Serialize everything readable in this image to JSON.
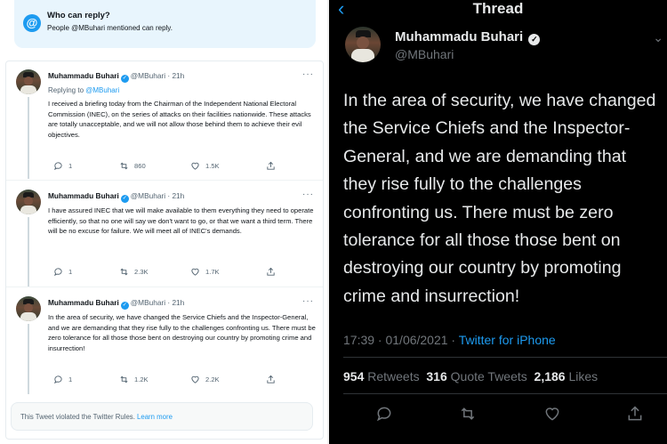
{
  "left": {
    "reply_banner": {
      "title": "Who can reply?",
      "subtitle": "People @MBuhari mentioned can reply."
    },
    "tweets": [
      {
        "name": "Muhammadu Buhari",
        "meta": "@MBuhari · 21h",
        "replying_prefix": "Replying to ",
        "replying_handle": "@MBuhari",
        "text": "I received a briefing today from the Chairman of the Independent National Electoral Commission (INEC), on the series of attacks on their facilities nationwide. These attacks are totally unacceptable, and we will not allow those behind them to achieve their evil objectives.",
        "replies": "1",
        "retweets": "860",
        "likes": "1.5K"
      },
      {
        "name": "Muhammadu Buhari",
        "meta": "@MBuhari · 21h",
        "text": "I have assured INEC that we will make available to them everything they need to operate efficiently, so that no one will say we don't want to go, or that we want a third term. There will be no excuse for failure. We will meet all of INEC's demands.",
        "replies": "1",
        "retweets": "2.3K",
        "likes": "1.7K"
      },
      {
        "name": "Muhammadu Buhari",
        "meta": "@MBuhari · 21h",
        "text": "In the area of security, we have changed the Service Chiefs and the Inspector-General, and we are demanding that they rise fully to the challenges confronting us. There must be zero tolerance for all those those bent on destroying our country by promoting crime and insurrection!",
        "replies": "1",
        "retweets": "1.2K",
        "likes": "2.2K"
      }
    ],
    "violation": {
      "text": "This Tweet violated the Twitter Rules. ",
      "link": "Learn more"
    }
  },
  "right": {
    "header_title": "Thread",
    "name": "Muhammadu Buhari",
    "handle": "@MBuhari",
    "body_lines": [
      "In the area of security, we have changed",
      "the Service Chiefs and the Inspector-",
      "General, and we are demanding that",
      "they rise fully to the challenges",
      "confronting us. There must be zero",
      "tolerance for all those those bent on",
      "destroying our country by promoting",
      "crime and insurrection!"
    ],
    "timestamp": "17:39 · 01/06/2021 · ",
    "source": "Twitter for iPhone",
    "retweets_count": "954",
    "retweets_label": " Retweets  ",
    "quotes_count": "316",
    "quotes_label": " Quote Tweets  ",
    "likes_count": "2,186",
    "likes_label": " Likes"
  },
  "icons": [
    "reply-icon",
    "retweet-icon",
    "like-icon",
    "share-icon",
    "verified-icon",
    "back-icon",
    "more-icon",
    "at-icon"
  ],
  "colors": {
    "accent": "#1d9bf0",
    "dark_bg": "#000000",
    "banner_bg": "#e8f5fd"
  }
}
